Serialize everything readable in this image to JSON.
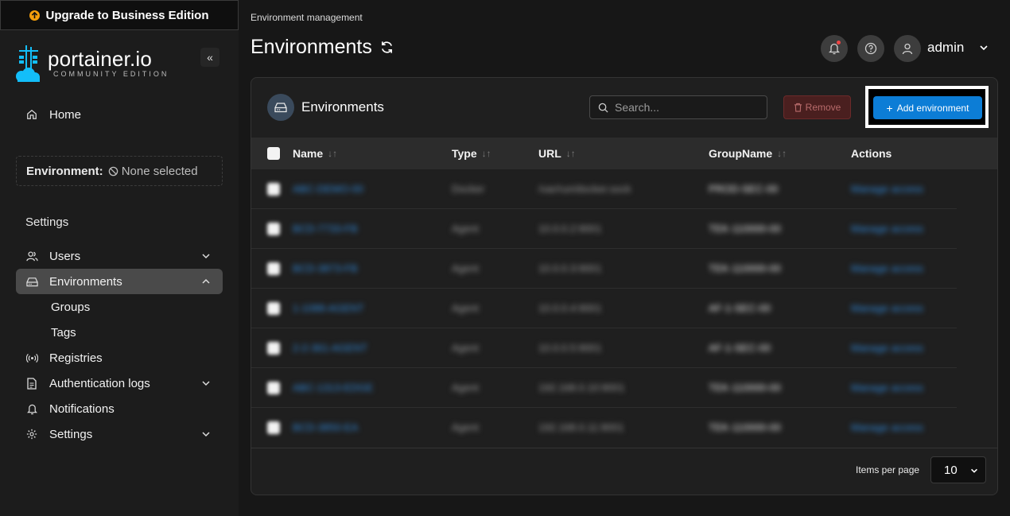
{
  "sidebar": {
    "upgrade_label": "Upgrade to Business Edition",
    "logo_text": "portainer.io",
    "logo_sub": "COMMUNITY EDITION",
    "collapse_label": "«",
    "home_label": "Home",
    "environment_label": "Environment:",
    "environment_value": "None selected",
    "settings_heading": "Settings",
    "items": [
      {
        "label": "Users",
        "icon": "users-icon",
        "expandable": true
      },
      {
        "label": "Environments",
        "icon": "drive-icon",
        "expandable": true,
        "active": true
      },
      {
        "label": "Registries",
        "icon": "radio-icon",
        "expandable": false
      },
      {
        "label": "Authentication logs",
        "icon": "file-icon",
        "expandable": true
      },
      {
        "label": "Notifications",
        "icon": "bell-icon",
        "expandable": false
      },
      {
        "label": "Settings",
        "icon": "gear-icon",
        "expandable": true
      }
    ],
    "sub_items": [
      "Groups",
      "Tags"
    ]
  },
  "header": {
    "breadcrumb": "Environment management",
    "title": "Environments",
    "user": "admin"
  },
  "panel": {
    "title": "Environments",
    "search_placeholder": "Search...",
    "remove_label": "Remove",
    "add_label": "Add environment",
    "columns": [
      "Name",
      "Type",
      "URL",
      "GroupName",
      "Actions"
    ],
    "rows": [
      {
        "name": "ABC-DEMO-00",
        "type": "Docker",
        "url": "/var/run/docker.sock",
        "group": "PROD-SEC-00",
        "action": "Manage access"
      },
      {
        "name": "BCD-7733-FB",
        "type": "Agent",
        "url": "10.0.0.2:9001",
        "group": "TEK-110000-00",
        "action": "Manage access"
      },
      {
        "name": "BCD-3873-FB",
        "type": "Agent",
        "url": "10.0.0.3:9001",
        "group": "TEK-110000-00",
        "action": "Manage access"
      },
      {
        "name": "1-1088-AGENT",
        "type": "Agent",
        "url": "10.0.0.4:9001",
        "group": "AF-1-SEC-00",
        "action": "Manage access"
      },
      {
        "name": "2-2-361-AGENT",
        "type": "Agent",
        "url": "10.0.0.5:9001",
        "group": "AF-1-SEC-00",
        "action": "Manage access"
      },
      {
        "name": "ABC-1313-EDGE",
        "type": "Agent",
        "url": "192.168.0.10:9001",
        "group": "TEK-110000-00",
        "action": "Manage access"
      },
      {
        "name": "BCD-3850-EA",
        "type": "Agent",
        "url": "192.168.0.11:9001",
        "group": "TEK-110000-00",
        "action": "Manage access"
      }
    ],
    "items_per_page_label": "Items per page",
    "items_per_page_value": "10"
  },
  "colors": {
    "accent": "#0c7dd6",
    "danger": "#4a1f1f",
    "link": "#2f86d6",
    "sidebar_bg": "#1c1c1c",
    "page_bg": "#171717"
  }
}
